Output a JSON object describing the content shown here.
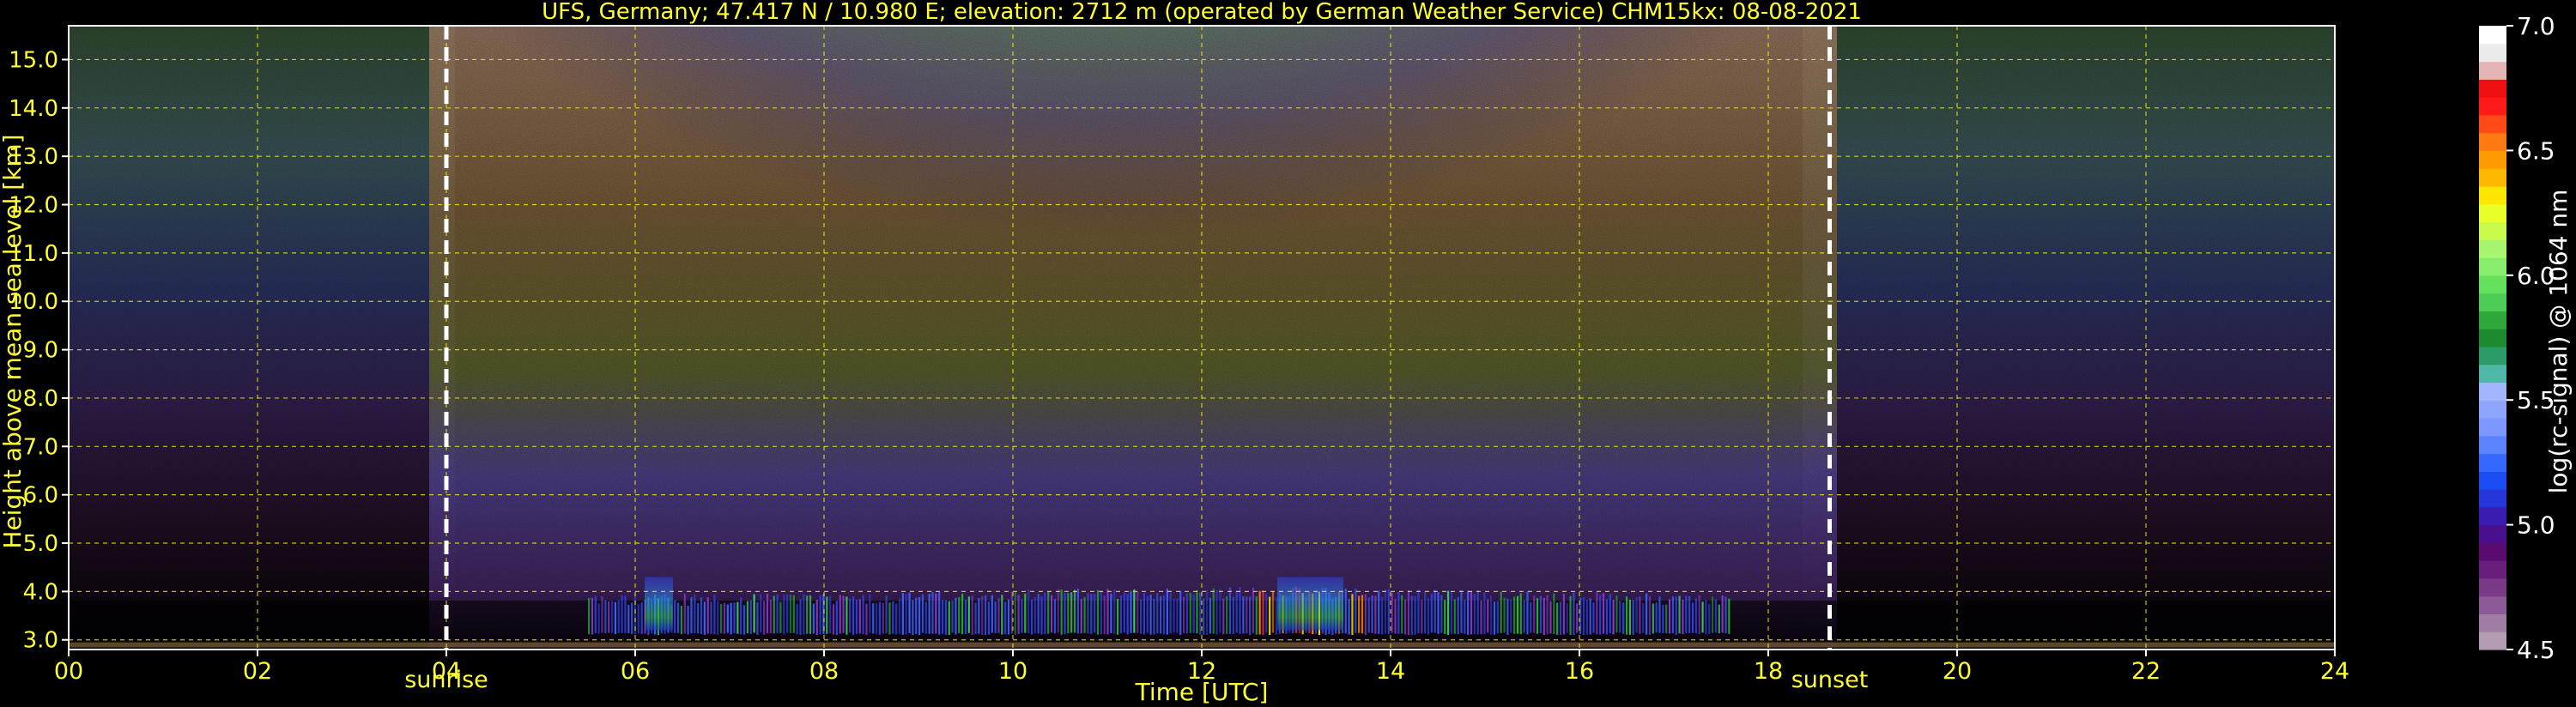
{
  "chart_data": {
    "type": "heatmap",
    "title": "UFS, Germany; 47.417 N / 10.980 E; elevation: 2712 m  (operated by German Weather Service)    CHM15kx: 08-08-2021",
    "xlabel": "Time [UTC]",
    "ylabel": "Height above mean sea level [km]",
    "xlim": [
      0,
      24
    ],
    "ylim": [
      2.8,
      15.7
    ],
    "x_ticks": [
      "00",
      "02",
      "04",
      "06",
      "08",
      "10",
      "12",
      "14",
      "16",
      "18",
      "20",
      "22",
      "24"
    ],
    "y_ticks": [
      "3.0",
      "4.0",
      "5.0",
      "6.0",
      "7.0",
      "8.0",
      "9.0",
      "10.0",
      "11.0",
      "12.0",
      "13.0",
      "14.0",
      "15.0"
    ],
    "grid": true,
    "events": [
      {
        "label": "sunrise",
        "time": 4.0
      },
      {
        "label": "sunset",
        "time": 18.65
      }
    ],
    "colorbar": {
      "label": "log(rc-signal) @ 1064 nm",
      "range": [
        4.5,
        7.0
      ],
      "ticks": [
        "4.5",
        "5.0",
        "5.5",
        "6.0",
        "6.5",
        "7.0"
      ],
      "colors": [
        "#b19cb0",
        "#a07fa6",
        "#8c5a96",
        "#7a3a88",
        "#6a1e7c",
        "#5a0b72",
        "#4a0f8e",
        "#3a1cb0",
        "#2536d8",
        "#1b4df2",
        "#3568ff",
        "#5b83ff",
        "#7a98ff",
        "#8fa6ff",
        "#a4b6ff",
        "#4fb8a8",
        "#2a9a66",
        "#1d8a2e",
        "#2fa83a",
        "#4ccd55",
        "#66e05f",
        "#86ee6c",
        "#a8f56f",
        "#c8fb4c",
        "#e8ff2a",
        "#ffe600",
        "#ffb800",
        "#ff9a00",
        "#ff7a10",
        "#ff4a18",
        "#ff1a1a",
        "#ee1010",
        "#e5b5b5",
        "#ececec",
        "#ffffff"
      ]
    }
  }
}
